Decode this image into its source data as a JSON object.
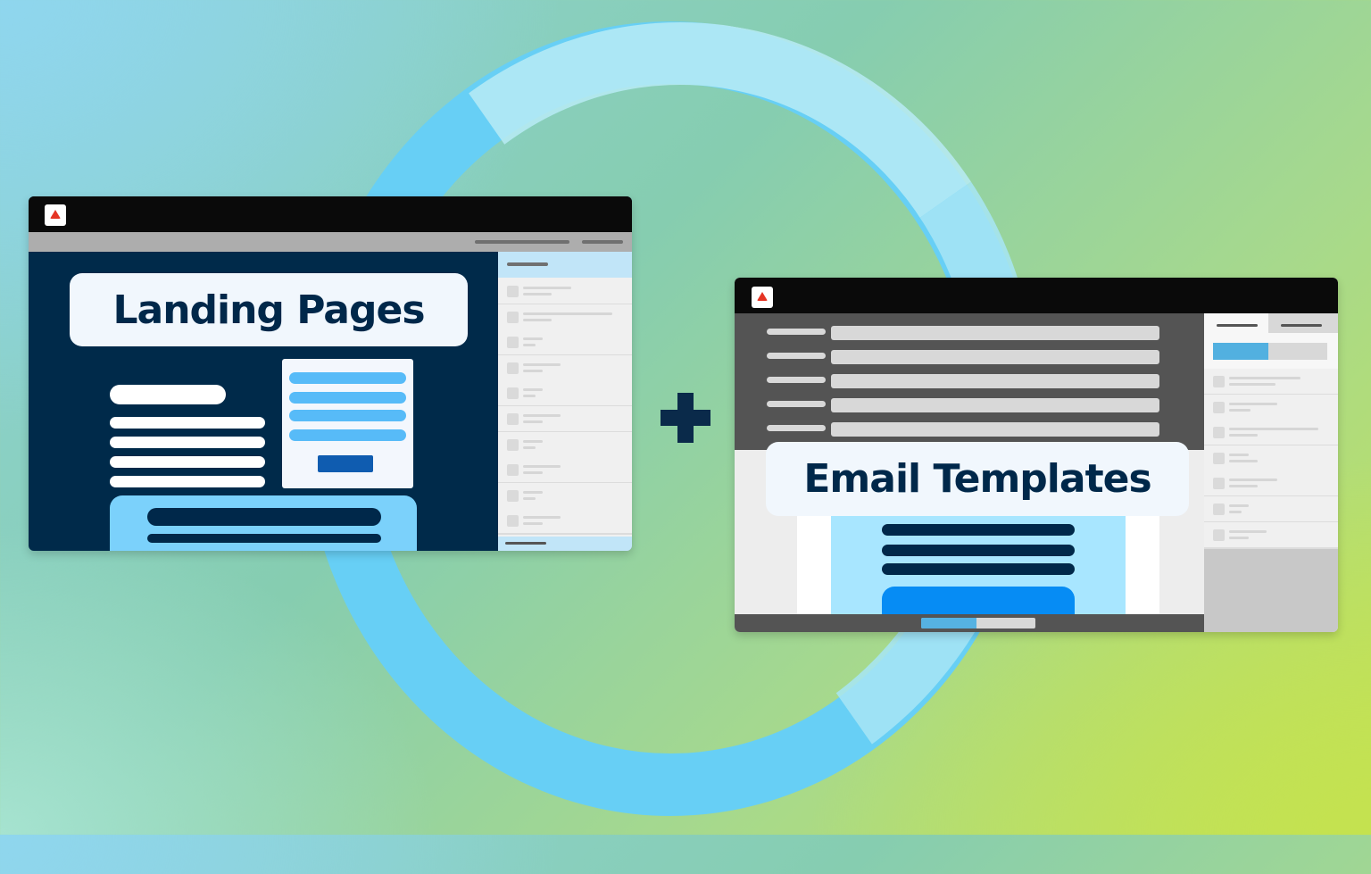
{
  "background": {
    "ring_color": "#67cff5",
    "navy": "#00284a",
    "accent_red": "#e53424"
  },
  "landing_window": {
    "title": "Landing Pages",
    "logo_icon": "brand-triangle-icon",
    "sidebar_rows": 10
  },
  "connector": {
    "symbol_icon": "plus-icon"
  },
  "email_window": {
    "title": "Email Templates",
    "logo_icon": "brand-triangle-icon",
    "form_rows": 5,
    "sidebar_rows": 7
  }
}
